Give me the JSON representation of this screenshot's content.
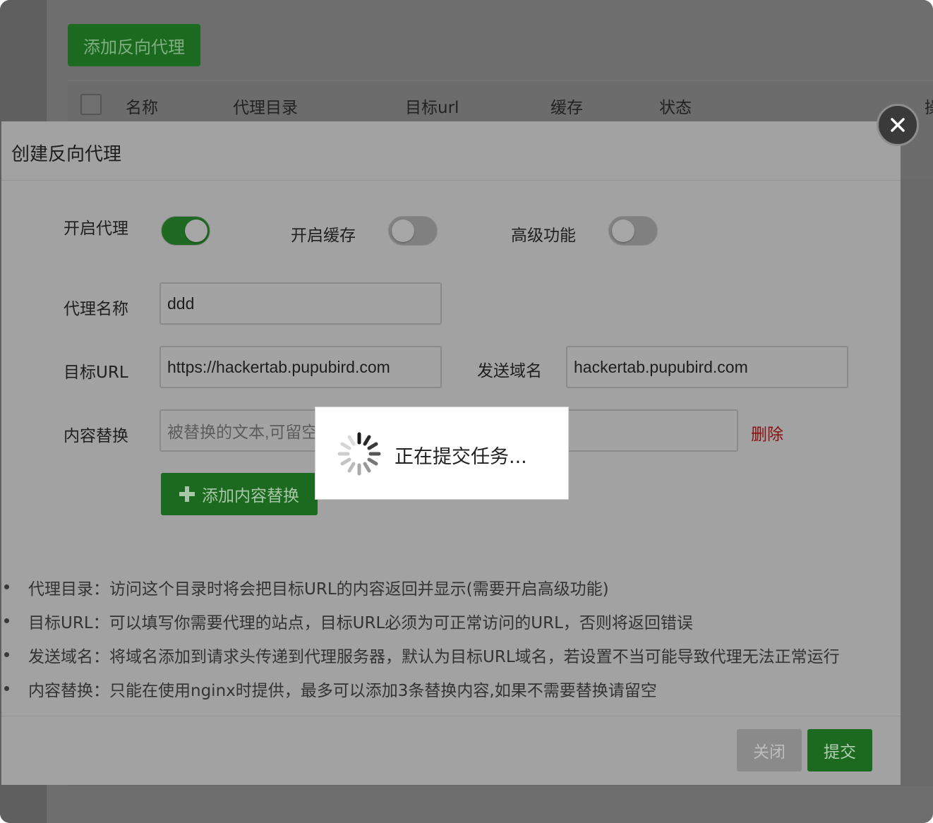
{
  "background": {
    "add_button_label": "添加反向代理",
    "columns": [
      "名称",
      "代理目录",
      "目标url",
      "缓存",
      "状态",
      "操"
    ]
  },
  "dialog": {
    "title": "创建反向代理",
    "toggles": [
      {
        "label": "开启代理",
        "on": true
      },
      {
        "label": "开启缓存",
        "on": false
      },
      {
        "label": "高级功能",
        "on": false
      }
    ],
    "proxy_name": {
      "label": "代理名称",
      "value": "ddd"
    },
    "target_url": {
      "label": "目标URL",
      "value": "https://hackertab.pupubird.com"
    },
    "send_domain": {
      "label": "发送域名",
      "value": "hackertab.pupubird.com"
    },
    "content_replace": {
      "label": "内容替换",
      "placeholder": "被替换的文本,可留空",
      "replacement_value": "",
      "delete_label": "删除"
    },
    "add_content_replace_label": "添加内容替换",
    "notes": [
      "代理目录：访问这个目录时将会把目标URL的内容返回并显示(需要开启高级功能)",
      "目标URL：可以填写你需要代理的站点，目标URL必须为可正常访问的URL，否则将返回错误",
      "发送域名：将域名添加到请求头传递到代理服务器，默认为目标URL域名，若设置不当可能导致代理无法正常运行",
      "内容替换：只能在使用nginx时提供，最多可以添加3条替换内容,如果不需要替换请留空"
    ],
    "close_label": "关闭",
    "submit_label": "提交"
  },
  "loading": {
    "text": "正在提交任务..."
  },
  "icons": {
    "close": "close-icon",
    "plus": "plus-icon",
    "spinner": "spinner-icon"
  },
  "colors": {
    "primary_green": "#1c6a20",
    "delete_red": "#8b1010"
  }
}
